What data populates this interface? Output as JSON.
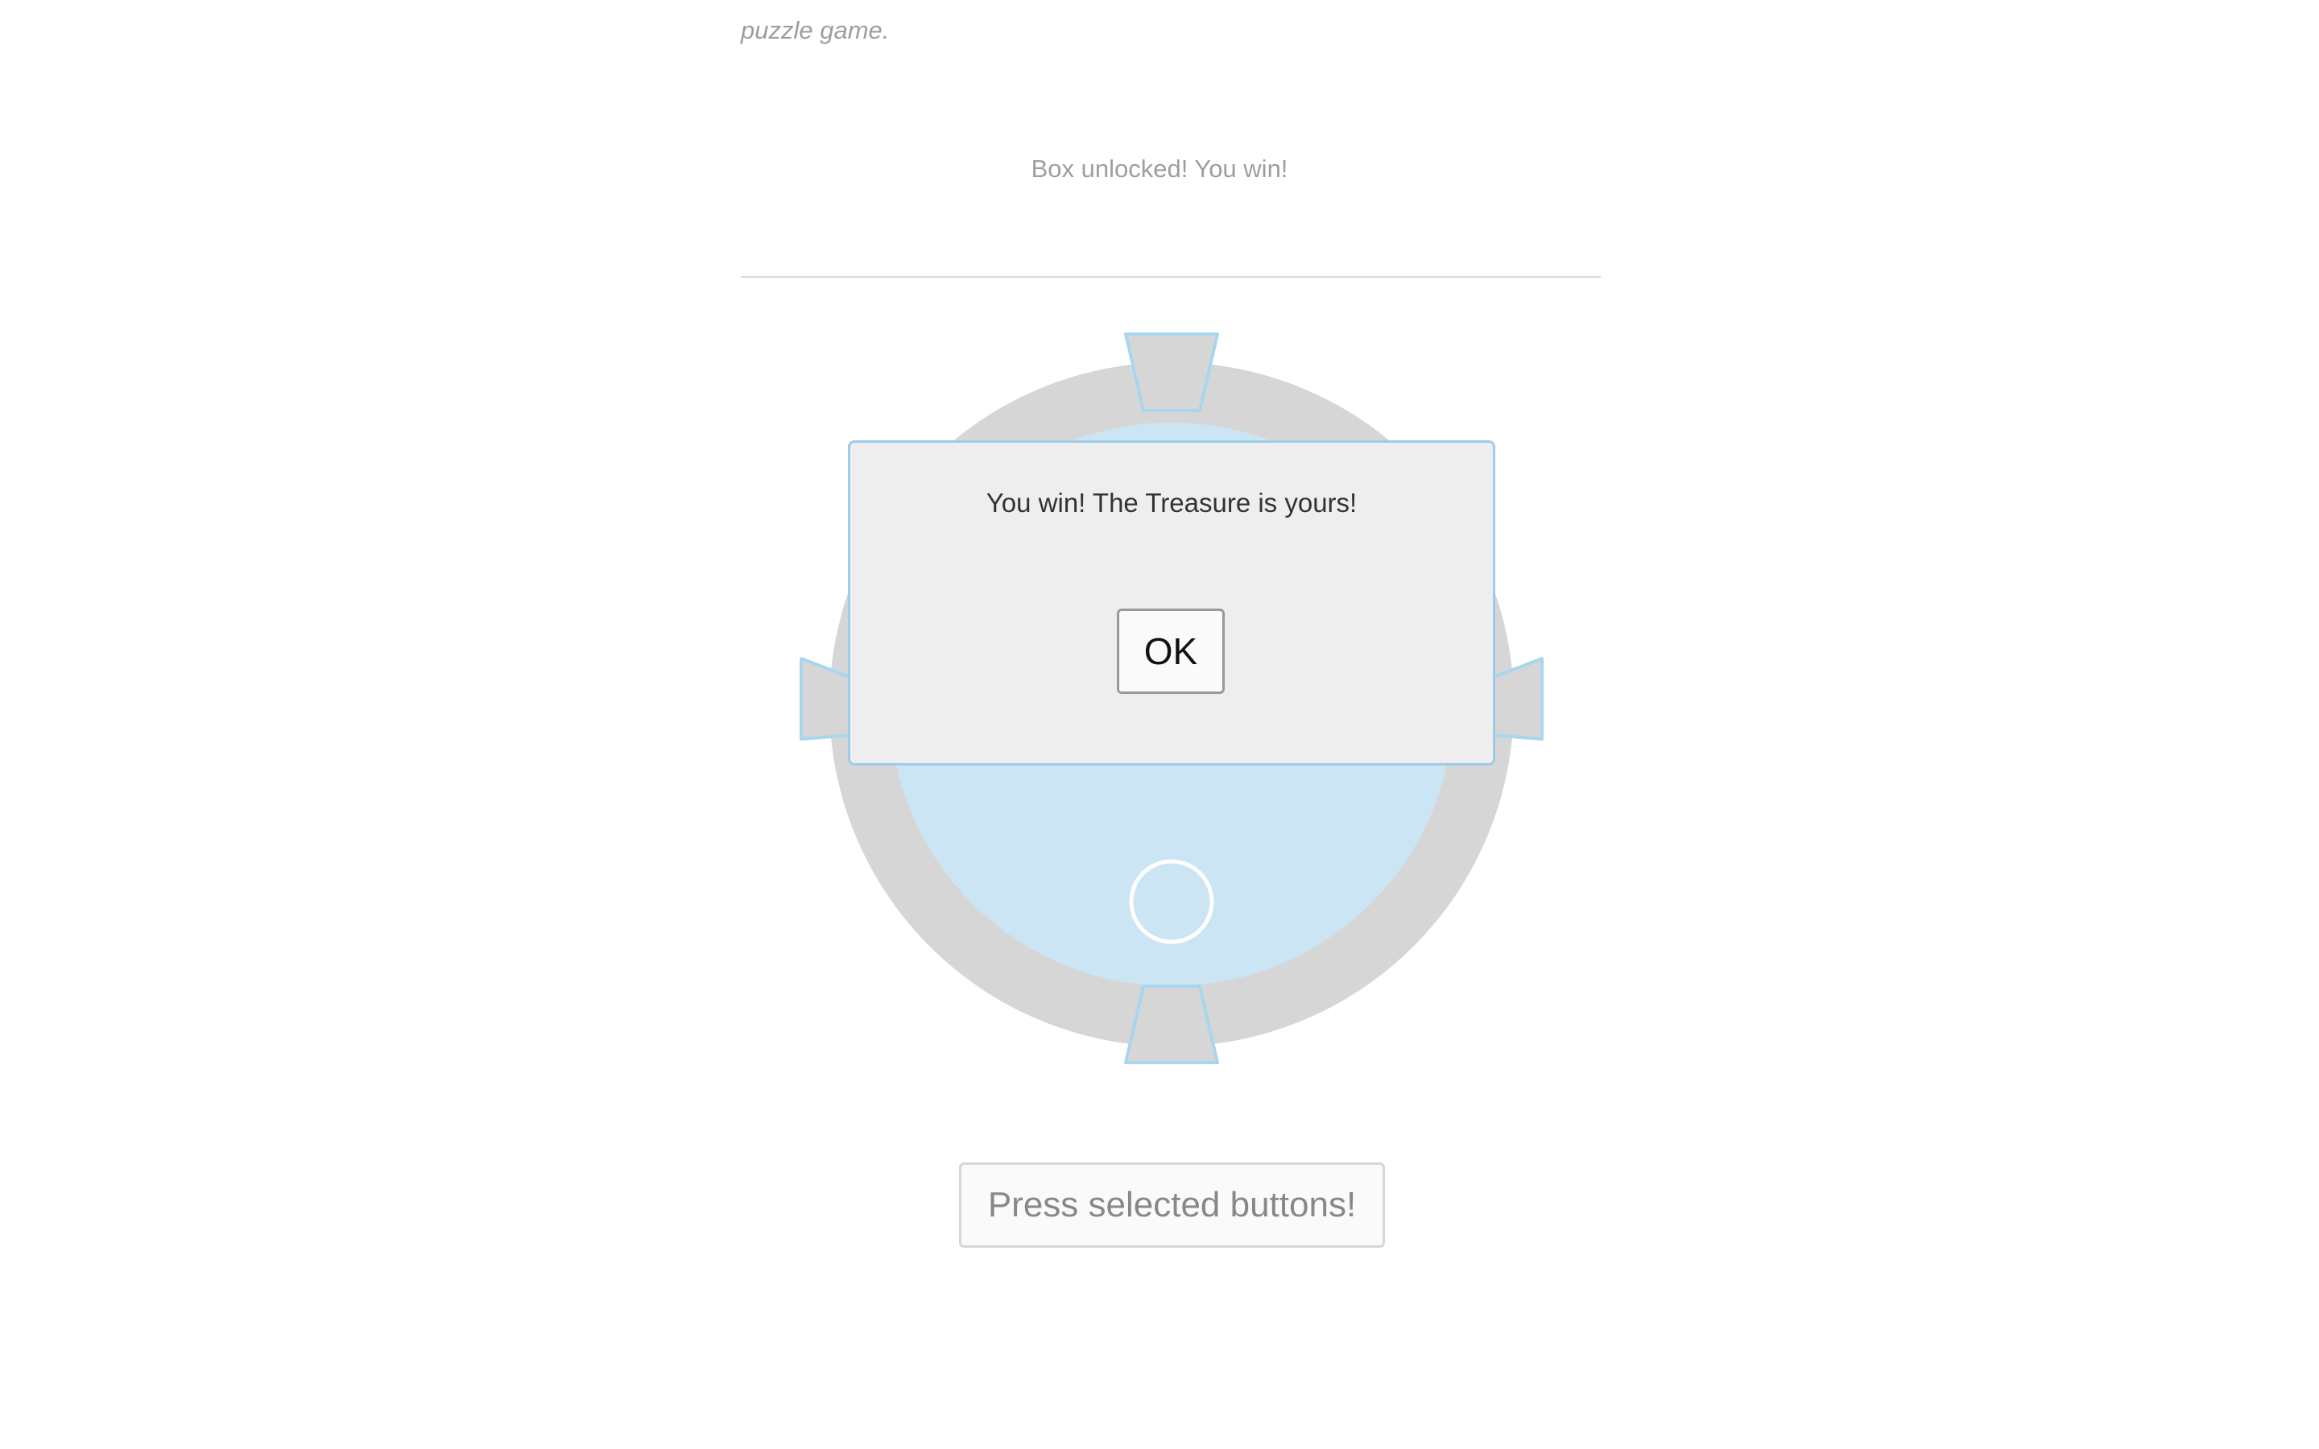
{
  "intro": {
    "text": "puzzle game."
  },
  "status": {
    "message": "Box unlocked! You win!"
  },
  "board": {
    "ring_color": "#d6d6d6",
    "inner_color": "#cce5f4",
    "outline_color": "#a9d6ee",
    "center_marker_color": "#ffffff",
    "buttons": [
      "top",
      "right",
      "bottom",
      "left"
    ]
  },
  "dialog": {
    "message": "You win! The Treasure is yours!",
    "ok_label": "OK"
  },
  "actions": {
    "press_label": "Press selected buttons!"
  }
}
